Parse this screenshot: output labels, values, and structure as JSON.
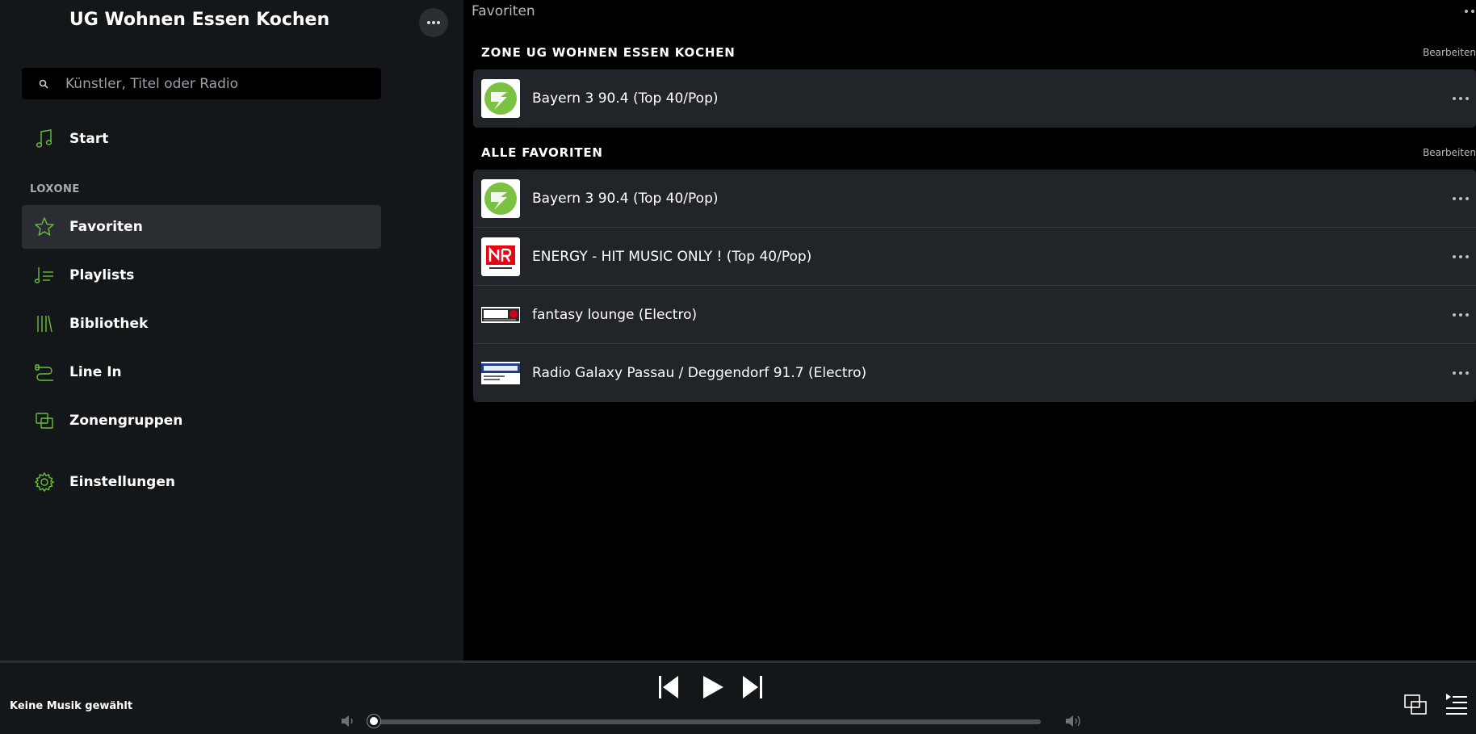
{
  "sidebar": {
    "zone_title": "UG Wohnen Essen Kochen",
    "search_placeholder": "Künstler, Titel oder Radio",
    "start_label": "Start",
    "section_label": "LOXONE",
    "items": [
      {
        "label": "Favoriten",
        "icon": "star-icon",
        "active": true
      },
      {
        "label": "Playlists",
        "icon": "playlist-icon"
      },
      {
        "label": "Bibliothek",
        "icon": "library-icon"
      },
      {
        "label": "Line In",
        "icon": "line-in-icon"
      },
      {
        "label": "Zonengruppen",
        "icon": "zone-groups-icon"
      }
    ],
    "settings_label": "Einstellungen",
    "accent_color": "#6abf3a"
  },
  "main": {
    "page_title": "Favoriten",
    "groups": [
      {
        "title": "ZONE UG WOHNEN ESSEN KOCHEN",
        "edit_label": "Bearbeiten",
        "rows": [
          {
            "title": "Bayern 3 90.4 (Top 40/Pop)",
            "logo": "bayern3-logo"
          }
        ]
      },
      {
        "title": "ALLE FAVORITEN",
        "edit_label": "Bearbeiten",
        "rows": [
          {
            "title": "Bayern 3 90.4 (Top 40/Pop)",
            "logo": "bayern3-logo"
          },
          {
            "title": "ENERGY - HIT MUSIC ONLY ! (Top 40/Pop)",
            "logo": "nrj-logo"
          },
          {
            "title": "fantasy lounge (Electro)",
            "logo": "lounge-logo"
          },
          {
            "title": "Radio Galaxy Passau / Deggendorf 91.7 (Electro)",
            "logo": "galaxy-logo"
          }
        ]
      }
    ]
  },
  "player": {
    "now_playing": "Keine Musik gewählt",
    "volume": 0
  }
}
